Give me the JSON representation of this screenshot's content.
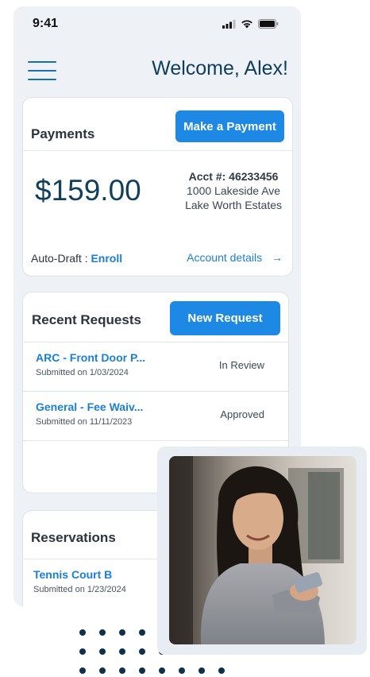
{
  "status_bar": {
    "time": "9:41"
  },
  "header": {
    "greeting": "Welcome, Alex!"
  },
  "payments": {
    "title": "Payments",
    "action_label": "Make a Payment",
    "amount": "$159.00",
    "account_number_label": "Acct #: 46233456",
    "address_line1": "1000 Lakeside Ave",
    "address_line2": "Lake Worth Estates",
    "autodraft_label": "Auto-Draft : ",
    "autodraft_action": "Enroll",
    "details_link": "Account details",
    "details_arrow": "→"
  },
  "requests": {
    "title": "Recent Requests",
    "action_label": "New Request",
    "items": [
      {
        "title": "ARC - Front Door P...",
        "submitted": "Submitted on 1/03/2024",
        "status": "In Review"
      },
      {
        "title": "General - Fee Waiv...",
        "submitted": "Submitted on 11/11/2023",
        "status": "Approved"
      }
    ]
  },
  "reservations": {
    "title": "Reservations",
    "items": [
      {
        "title": "Tennis Court B",
        "submitted": "Submitted on 1/23/2024"
      }
    ]
  },
  "colors": {
    "accent": "#1e88e5",
    "link": "#1a7fd8",
    "heading": "#0f3d5c",
    "background": "#eef1f5"
  },
  "icons": [
    "signal-icon",
    "wifi-icon",
    "battery-icon",
    "menu-icon",
    "arrow-right-icon"
  ]
}
